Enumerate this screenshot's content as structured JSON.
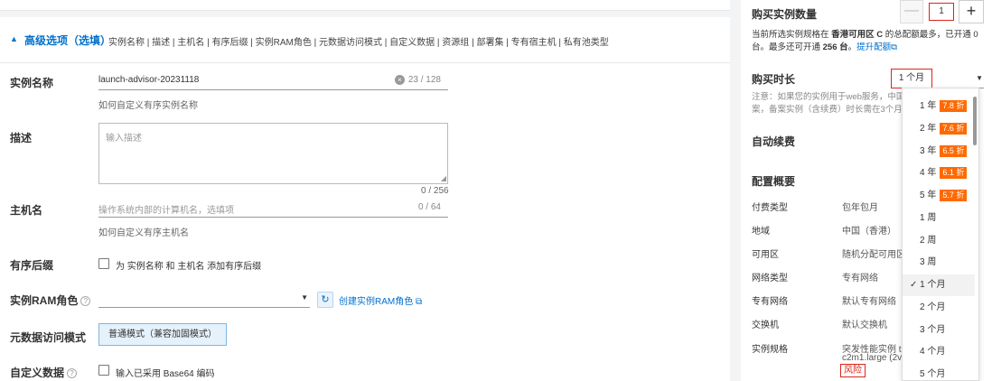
{
  "advanced": {
    "caret": "▲",
    "title": "高级选项（选填）",
    "subtitle": "实例名称 | 描述 | 主机名 | 有序后缀 | 实例RAM角色 | 元数据访问模式 | 自定义数据 | 资源组 | 部署集 | 专有宿主机 | 私有池类型"
  },
  "form": {
    "instance_name": {
      "label": "实例名称",
      "value": "launch-advisor-20231118",
      "count": "23 / 128",
      "hint": "如何自定义有序实例名称"
    },
    "description": {
      "label": "描述",
      "placeholder": "输入描述",
      "count": "0 / 256"
    },
    "hostname": {
      "label": "主机名",
      "placeholder": "操作系统内部的计算机名，选填项",
      "count": "0 / 64",
      "hint": "如何自定义有序主机名"
    },
    "suffix": {
      "label": "有序后缀",
      "checkbox_text": "为 实例名称 和 主机名 添加有序后缀"
    },
    "ram_role": {
      "label": "实例RAM角色",
      "help": "?",
      "link": "创建实例RAM角色"
    },
    "metadata": {
      "label": "元数据访问模式",
      "button": "普通模式（兼容加固模式）"
    },
    "user_data": {
      "label": "自定义数据",
      "help": "?",
      "checkbox_text": "输入已采用 Base64 编码"
    }
  },
  "right": {
    "quantity": {
      "title": "购买实例数量",
      "minus": "—",
      "value": "1",
      "plus": "+"
    },
    "quota_note": {
      "prefix": "当前所选实例规格在 ",
      "zone": "香港可用区 C",
      "middle": " 的总配额最多，已开通 0 台。最多还可开通 ",
      "count": "256 台",
      "suffix": "。",
      "link": "提升配额"
    },
    "duration": {
      "title": "购买时长",
      "value": "1 个月",
      "arrow": "▼"
    },
    "notice_line1": "注意：如果您的实例用于web服务，中国",
    "notice_line2": "案，备案实例（含续费）时长需在3个月",
    "auto_renew": "自动续费",
    "summary": {
      "title": "配置概要",
      "rows": [
        {
          "label": "付费类型",
          "value": "包年包月"
        },
        {
          "label": "地域",
          "value": "中国（香港）"
        },
        {
          "label": "可用区",
          "value": "随机分配可用区"
        },
        {
          "label": "网络类型",
          "value": "专有网络"
        },
        {
          "label": "专有网络",
          "value": "默认专有网络"
        },
        {
          "label": "交换机",
          "value": "默认交换机"
        },
        {
          "label": "实例规格",
          "value": "突发性能实例 t6",
          "value2": "c2m1.large (2vC",
          "risk": "风险"
        }
      ]
    }
  },
  "dropdown": {
    "check": "✓",
    "items": [
      {
        "label": "1 年",
        "badge": "7.8 折"
      },
      {
        "label": "2 年",
        "badge": "7.6 折"
      },
      {
        "label": "3 年",
        "badge": "6.5 折"
      },
      {
        "label": "4 年",
        "badge": "6.1 折"
      },
      {
        "label": "5 年",
        "badge": "5.7 折"
      },
      {
        "label": "1 周"
      },
      {
        "label": "2 周"
      },
      {
        "label": "3 周"
      },
      {
        "label": "1 个月",
        "selected": true
      },
      {
        "label": "2 个月"
      },
      {
        "label": "3 个月"
      },
      {
        "label": "4 个月"
      },
      {
        "label": "5 个月"
      }
    ]
  },
  "colors": {
    "accent": "#0070cc",
    "alert_red": "#d9261c",
    "discount": "#ff6a00"
  }
}
